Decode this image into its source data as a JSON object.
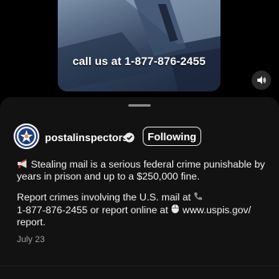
{
  "video": {
    "caption": "call us at 1-877-876-2455",
    "sound_icon": "volume-icon"
  },
  "post": {
    "username": "postalinspectors",
    "verified_icon": "verified-badge-icon",
    "follow_label": "Following",
    "paragraph1": "Stealing mail is a serious federal crime punishable by years in prison and up to a $250,000 fine.",
    "paragraph2_a": "Report crimes involving the U.S. mail at",
    "paragraph2_b": "1-877-876-2455 or report online at",
    "paragraph2_c": "www.uspis.gov/",
    "paragraph2_d": "report.",
    "date": "July 23"
  },
  "colors": {
    "background": "#000000",
    "sheet": "#121212",
    "text": "#f0f0f0",
    "muted": "#9a9a9a"
  }
}
